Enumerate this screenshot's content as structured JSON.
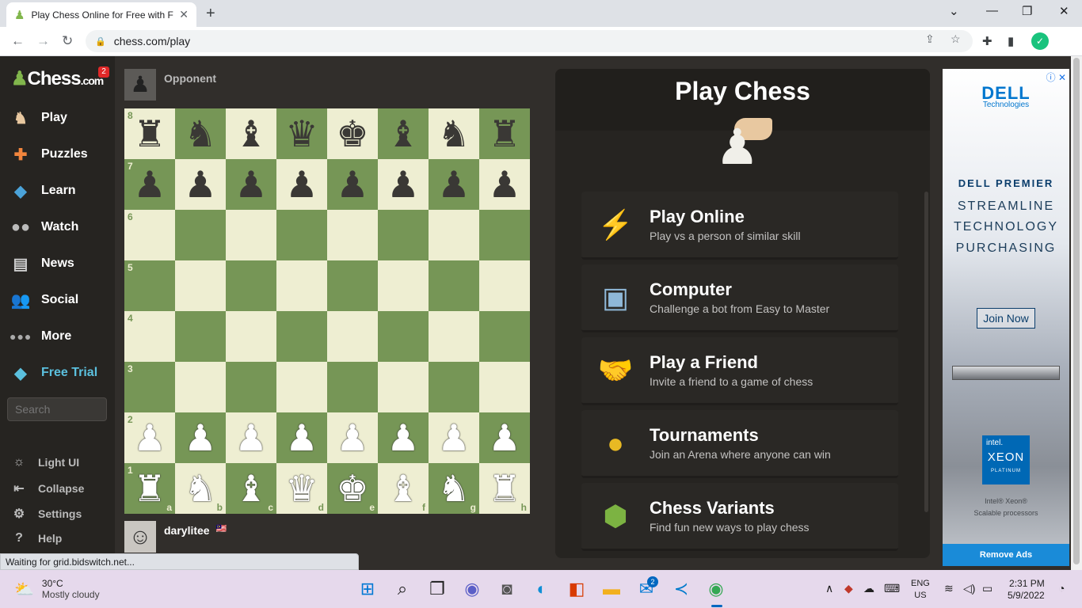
{
  "browser": {
    "tab_title": "Play Chess Online for Free with F",
    "url": "chess.com/play",
    "icons": [
      "back-arrow-icon",
      "forward-arrow-icon",
      "reload-icon",
      "lock-icon",
      "share-icon",
      "star-icon",
      "extensions-icon",
      "sidepanel-icon",
      "profile-icon"
    ]
  },
  "sidebar": {
    "logo_text": "Chess",
    "logo_domain": ".com",
    "notification_count": "2",
    "items": [
      {
        "label": "Play",
        "icon": "play-icon"
      },
      {
        "label": "Puzzles",
        "icon": "puzzle-icon"
      },
      {
        "label": "Learn",
        "icon": "graduation-cap-icon"
      },
      {
        "label": "Watch",
        "icon": "binoculars-icon"
      },
      {
        "label": "News",
        "icon": "newspaper-icon"
      },
      {
        "label": "Social",
        "icon": "people-icon"
      },
      {
        "label": "More",
        "icon": "dots-icon"
      },
      {
        "label": "Free Trial",
        "icon": "diamond-icon"
      }
    ],
    "search_placeholder": "Search",
    "bottom_items": [
      {
        "label": "Light UI",
        "icon": "sun-icon"
      },
      {
        "label": "Collapse",
        "icon": "collapse-icon"
      },
      {
        "label": "Settings",
        "icon": "gear-icon"
      },
      {
        "label": "Help",
        "icon": "help-icon"
      }
    ]
  },
  "game": {
    "opponent_name": "Opponent",
    "player_name": "darylitee",
    "player_flag": "🇲🇾",
    "ranks": [
      "8",
      "7",
      "6",
      "5",
      "4",
      "3",
      "2",
      "1"
    ],
    "files": [
      "a",
      "b",
      "c",
      "d",
      "e",
      "f",
      "g",
      "h"
    ],
    "position": [
      [
        "♜",
        "♞",
        "♝",
        "♛",
        "♚",
        "♝",
        "♞",
        "♜"
      ],
      [
        "♟",
        "♟",
        "♟",
        "♟",
        "♟",
        "♟",
        "♟",
        "♟"
      ],
      [
        "",
        "",
        "",
        "",
        "",
        "",
        "",
        ""
      ],
      [
        "",
        "",
        "",
        "",
        "",
        "",
        "",
        ""
      ],
      [
        "",
        "",
        "",
        "",
        "",
        "",
        "",
        ""
      ],
      [
        "",
        "",
        "",
        "",
        "",
        "",
        "",
        ""
      ],
      [
        "♟",
        "♟",
        "♟",
        "♟",
        "♟",
        "♟",
        "♟",
        "♟"
      ],
      [
        "♜",
        "♞",
        "♝",
        "♛",
        "♚",
        "♝",
        "♞",
        "♜"
      ]
    ],
    "light_color": "#eeeed2",
    "dark_color": "#769656"
  },
  "play_panel": {
    "title": "Play Chess",
    "options": [
      {
        "title": "Play Online",
        "subtitle": "Play vs a person of similar skill",
        "icon": "lightning-icon"
      },
      {
        "title": "Computer",
        "subtitle": "Challenge a bot from Easy to Master",
        "icon": "computer-icon"
      },
      {
        "title": "Play a Friend",
        "subtitle": "Invite a friend to a game of chess",
        "icon": "handshake-icon"
      },
      {
        "title": "Tournaments",
        "subtitle": "Join an Arena where anyone can win",
        "icon": "medal-icon"
      },
      {
        "title": "Chess Variants",
        "subtitle": "Find fun new ways to play chess",
        "icon": "dice-icon"
      }
    ]
  },
  "ad": {
    "brand": "DELL",
    "brand_sub": "Technologies",
    "line1": "DELL PREMIER",
    "line2": "STREAMLINE",
    "line3": "TECHNOLOGY",
    "line4": "PURCHASING",
    "cta": "Join Now",
    "chip_brand": "intel.",
    "chip_name": "XEON",
    "chip_tier": "PLATINUM",
    "small1": "Intel® Xeon®",
    "small2": "Scalable processors",
    "remove_ads": "Remove Ads"
  },
  "status_text": "Waiting for grid.bidswitch.net...",
  "taskbar": {
    "temperature": "30°C",
    "weather": "Mostly cloudy",
    "mail_badge": "2",
    "lang1": "ENG",
    "lang2": "US",
    "time": "2:31 PM",
    "date": "5/9/2022"
  }
}
